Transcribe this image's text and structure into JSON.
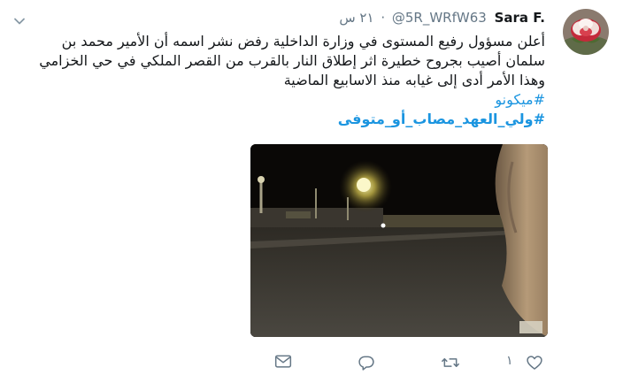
{
  "tweet": {
    "display_name": "Sara F.",
    "handle": "@5R_WRfW63",
    "separator": "·",
    "timestamp": "٢١ س",
    "text_lines": [
      "أعلن مسؤول رفيع المستوى في وزارة الداخلية رفض نشر اسمه أن الأمير محمد بن",
      "سلمان أصيب بجروح خطيرة اثر إطلاق النار بالقرب من القصر الملكي في حي الخزامي",
      "وهذا الأمر أدى إلى غيابه منذ الاسابيع الماضية"
    ],
    "hashtags": [
      "#ميكونو",
      "#ولي_العهد_مصاب_أو_متوفى"
    ],
    "like_count": "١",
    "link_color": "#1b95e0"
  },
  "icons": {
    "chevron": "chevron-down-icon",
    "reply": "reply-icon",
    "retweet": "retweet-icon",
    "like": "heart-icon",
    "dm": "envelope-icon"
  }
}
